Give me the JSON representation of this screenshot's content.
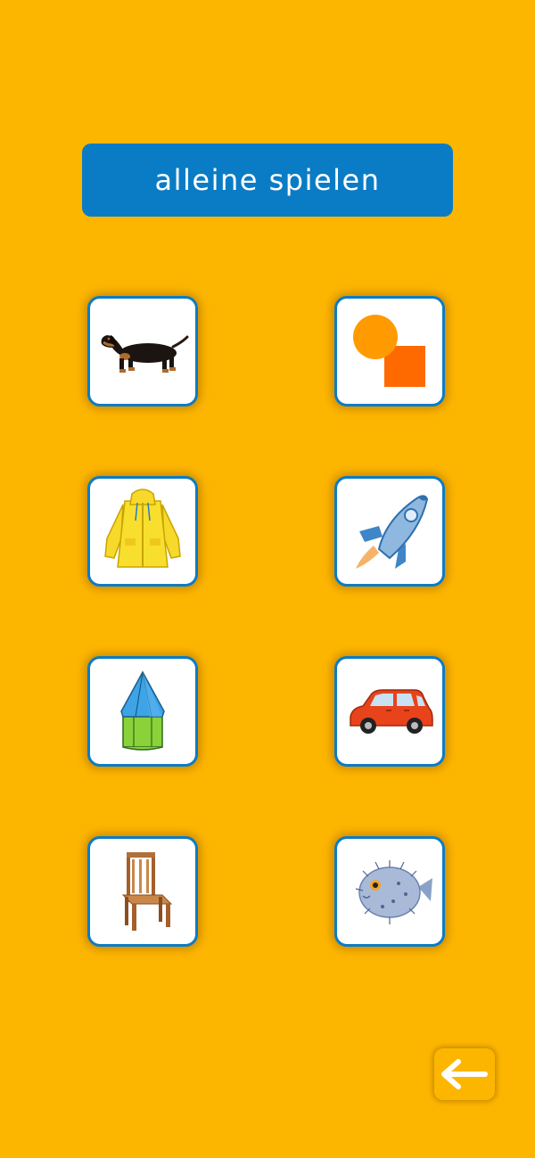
{
  "header": {
    "title": "alleine spielen"
  },
  "cards": [
    {
      "icon": "dachshund-dog-icon"
    },
    {
      "icon": "circle-square-shapes-icon"
    },
    {
      "icon": "yellow-raincoat-icon"
    },
    {
      "icon": "rocket-icon"
    },
    {
      "icon": "hexagonal-pyramid-prism-icon"
    },
    {
      "icon": "red-car-icon"
    },
    {
      "icon": "wooden-chair-icon"
    },
    {
      "icon": "pufferfish-icon"
    }
  ],
  "footer": {
    "back_icon": "arrow-left-icon"
  },
  "colors": {
    "background": "#FDB600",
    "accent": "#0A7CC6"
  }
}
